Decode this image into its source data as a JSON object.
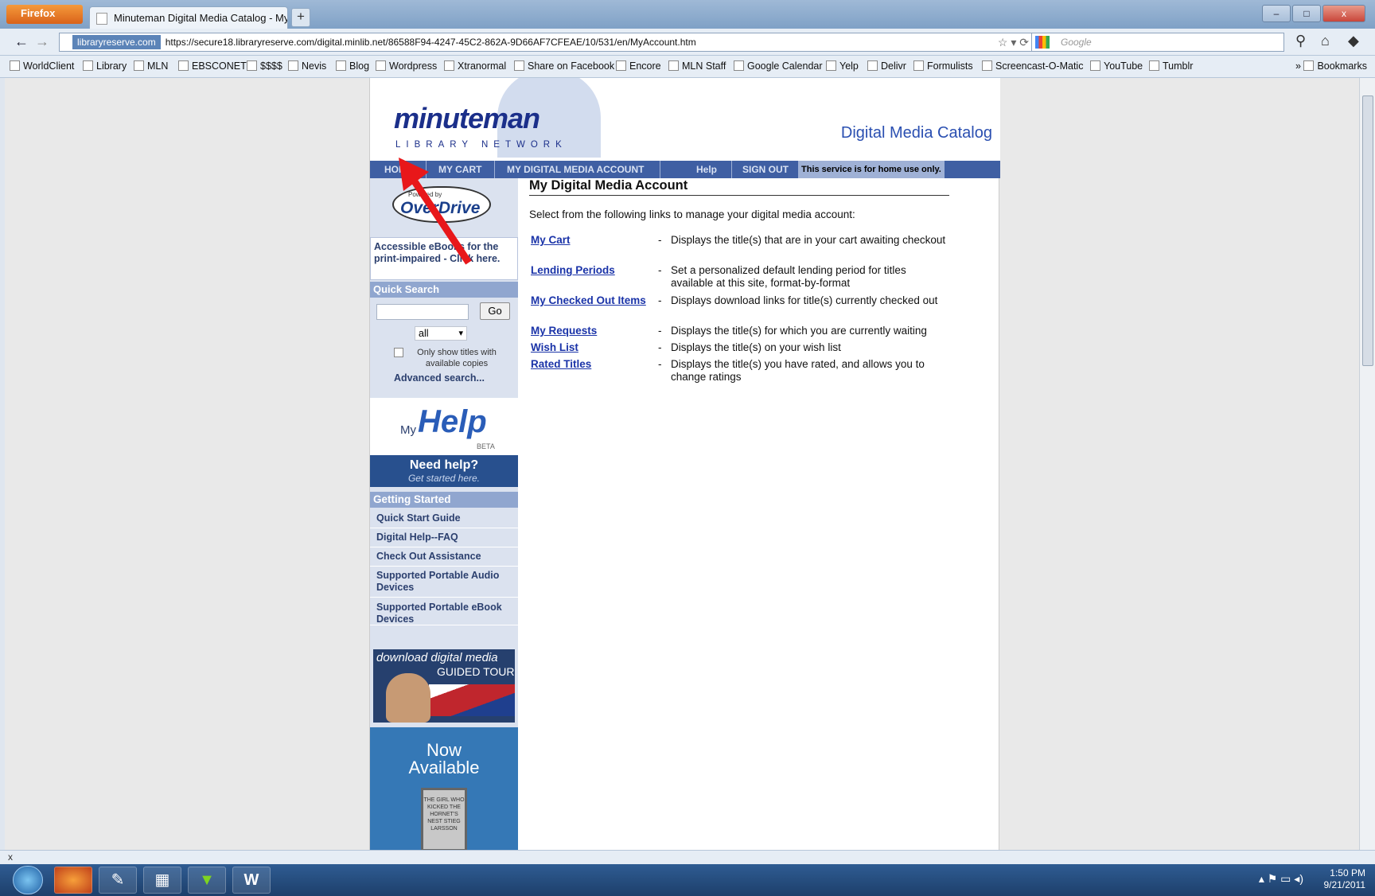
{
  "browser": {
    "app_button": "Firefox",
    "tab_title": "Minuteman Digital Media Catalog - My ...",
    "new_tab": "+",
    "window_controls": [
      "–",
      "□",
      "x"
    ],
    "site_identity": "libraryreserve.com",
    "url": "https://secure18.libraryreserve.com/digital.minlib.net/86588F94-4247-45C2-862A-9D66AF7CFEAE/10/531/en/MyAccount.htm",
    "search_placeholder": "Google",
    "bookmarks": [
      "WorldClient",
      "Library",
      "MLN",
      "EBSCONET",
      "$$$$",
      "Nevis",
      "Blog",
      "Wordpress",
      "Xtranormal",
      "Share on Facebook",
      "Encore",
      "MLN Staff",
      "Google Calendar",
      "Yelp",
      "Delivr",
      "Formulists",
      "Screencast-O-Matic",
      "YouTube",
      "Tumblr"
    ],
    "bookmarks_menu": "Bookmarks",
    "status_close": "x"
  },
  "site": {
    "logo": "minuteman",
    "logo_sub": "LIBRARY NETWORK",
    "catalog_title": "Digital Media Catalog",
    "menu": [
      "HOME",
      "MY CART",
      "MY DIGITAL MEDIA ACCOUNT",
      "Help",
      "SIGN OUT"
    ],
    "menu_note": "This service is for home use only.",
    "overdrive_powered": "Powered by",
    "overdrive_name": "OverDrive",
    "accessible_text": "Accessible eBooks for the print-impaired - Click here.",
    "quick_search": {
      "heading": "Quick Search",
      "go": "Go",
      "format": "all",
      "checkbox_label": "Only show titles with available copies",
      "advanced": "Advanced search..."
    },
    "myhelp": {
      "my": "My",
      "help": "Help",
      "beta": "BETA",
      "need": "Need help?",
      "started": "Get started here."
    },
    "getting_started": {
      "heading": "Getting Started",
      "items": [
        "Quick Start Guide",
        "Digital Help--FAQ",
        "Check Out Assistance",
        "Supported Portable Audio Devices",
        "Supported Portable eBook Devices"
      ]
    },
    "promo_download": {
      "line1": "download digital media",
      "line2": "GUIDED TOUR"
    },
    "promo_now": {
      "line1": "Now",
      "line2": "Available",
      "book": "THE GIRL WHO KICKED THE HORNET'S NEST STIEG LARSSON"
    }
  },
  "main": {
    "title": "My Digital Media Account",
    "intro": "Select from the following links to manage your digital media account:",
    "links": [
      {
        "label": "My Cart",
        "desc": "Displays the title(s) that are in your cart awaiting checkout"
      },
      {
        "label": "Lending Periods",
        "desc": "Set a personalized default lending period for titles available at this site, format-by-format"
      },
      {
        "label": "My Checked Out Items",
        "desc": "Displays download links for title(s) currently checked out"
      },
      {
        "label": "My Requests",
        "desc": "Displays the title(s) for which you are currently waiting"
      },
      {
        "label": "Wish List",
        "desc": "Displays the title(s) on your wish list"
      },
      {
        "label": "Rated Titles",
        "desc": "Displays the title(s) you have rated, and allows you to change ratings"
      }
    ],
    "dash": "-"
  },
  "taskbar": {
    "time": "1:50 PM",
    "date": "9/21/2011"
  },
  "colors": {
    "menu_bg": "#3f5fa3",
    "link": "#1a33a8",
    "annotation_arrow": "#e8171a"
  }
}
